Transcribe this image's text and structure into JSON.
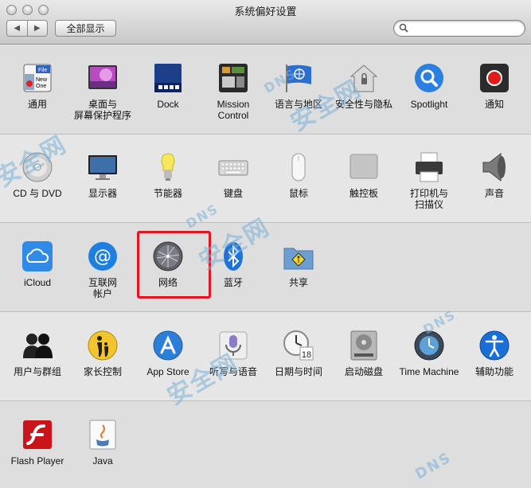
{
  "window": {
    "title": "系统偏好设置"
  },
  "toolbar": {
    "back_icon": "chevron-left-icon",
    "forward_icon": "chevron-right-icon",
    "back_glyph": "◀",
    "forward_glyph": "▶",
    "show_all_label": "全部显示",
    "search_placeholder": ""
  },
  "rows": [
    {
      "items": [
        {
          "id": "general",
          "label": "通用",
          "icon": "general-icon"
        },
        {
          "id": "desktop",
          "label": "桌面与\n屏幕保护程序",
          "icon": "desktop-screensaver-icon"
        },
        {
          "id": "dock",
          "label": "Dock",
          "icon": "dock-icon"
        },
        {
          "id": "mission",
          "label": "Mission\nControl",
          "icon": "mission-control-icon"
        },
        {
          "id": "language",
          "label": "语言与地区",
          "icon": "language-region-icon"
        },
        {
          "id": "security",
          "label": "安全性与隐私",
          "icon": "security-privacy-icon"
        },
        {
          "id": "spotlight",
          "label": "Spotlight",
          "icon": "spotlight-icon"
        },
        {
          "id": "notifications",
          "label": "通知",
          "icon": "notifications-icon"
        }
      ]
    },
    {
      "items": [
        {
          "id": "cddvd",
          "label": "CD 与 DVD",
          "icon": "cd-dvd-icon"
        },
        {
          "id": "displays",
          "label": "显示器",
          "icon": "displays-icon"
        },
        {
          "id": "energy",
          "label": "节能器",
          "icon": "energy-saver-icon"
        },
        {
          "id": "keyboard",
          "label": "键盘",
          "icon": "keyboard-icon"
        },
        {
          "id": "mouse",
          "label": "鼠标",
          "icon": "mouse-icon"
        },
        {
          "id": "trackpad",
          "label": "触控板",
          "icon": "trackpad-icon"
        },
        {
          "id": "printers",
          "label": "打印机与\n扫描仪",
          "icon": "printer-icon"
        },
        {
          "id": "sound",
          "label": "声音",
          "icon": "sound-icon"
        }
      ]
    },
    {
      "items": [
        {
          "id": "icloud",
          "label": "iCloud",
          "icon": "icloud-icon"
        },
        {
          "id": "internet",
          "label": "互联网\n帐户",
          "icon": "internet-accounts-icon"
        },
        {
          "id": "network",
          "label": "网络",
          "icon": "network-icon"
        },
        {
          "id": "bluetooth",
          "label": "蓝牙",
          "icon": "bluetooth-icon"
        },
        {
          "id": "sharing",
          "label": "共享",
          "icon": "sharing-icon"
        }
      ]
    },
    {
      "items": [
        {
          "id": "users",
          "label": "用户与群组",
          "icon": "users-groups-icon"
        },
        {
          "id": "parental",
          "label": "家长控制",
          "icon": "parental-controls-icon"
        },
        {
          "id": "appstore",
          "label": "App Store",
          "icon": "app-store-icon"
        },
        {
          "id": "dictation",
          "label": "听写与语音",
          "icon": "dictation-speech-icon"
        },
        {
          "id": "datetime",
          "label": "日期与时间",
          "icon": "date-time-icon"
        },
        {
          "id": "startup",
          "label": "启动磁盘",
          "icon": "startup-disk-icon"
        },
        {
          "id": "timemachine",
          "label": "Time Machine",
          "icon": "time-machine-icon"
        },
        {
          "id": "accessibility",
          "label": "辅助功能",
          "icon": "accessibility-icon"
        }
      ]
    },
    {
      "items": [
        {
          "id": "flash",
          "label": "Flash Player",
          "icon": "flash-player-icon"
        },
        {
          "id": "java",
          "label": "Java",
          "icon": "java-icon"
        }
      ]
    }
  ],
  "icon_text": {
    "general_file": "File",
    "general_new": "New",
    "general_one": "One",
    "date_day": "18"
  },
  "highlighted_item": "network",
  "watermark": {
    "text1": "DNS",
    "text2": "安全网"
  },
  "colors": {
    "highlight": "#e2171e",
    "titlebar": "#d4d4d4"
  }
}
